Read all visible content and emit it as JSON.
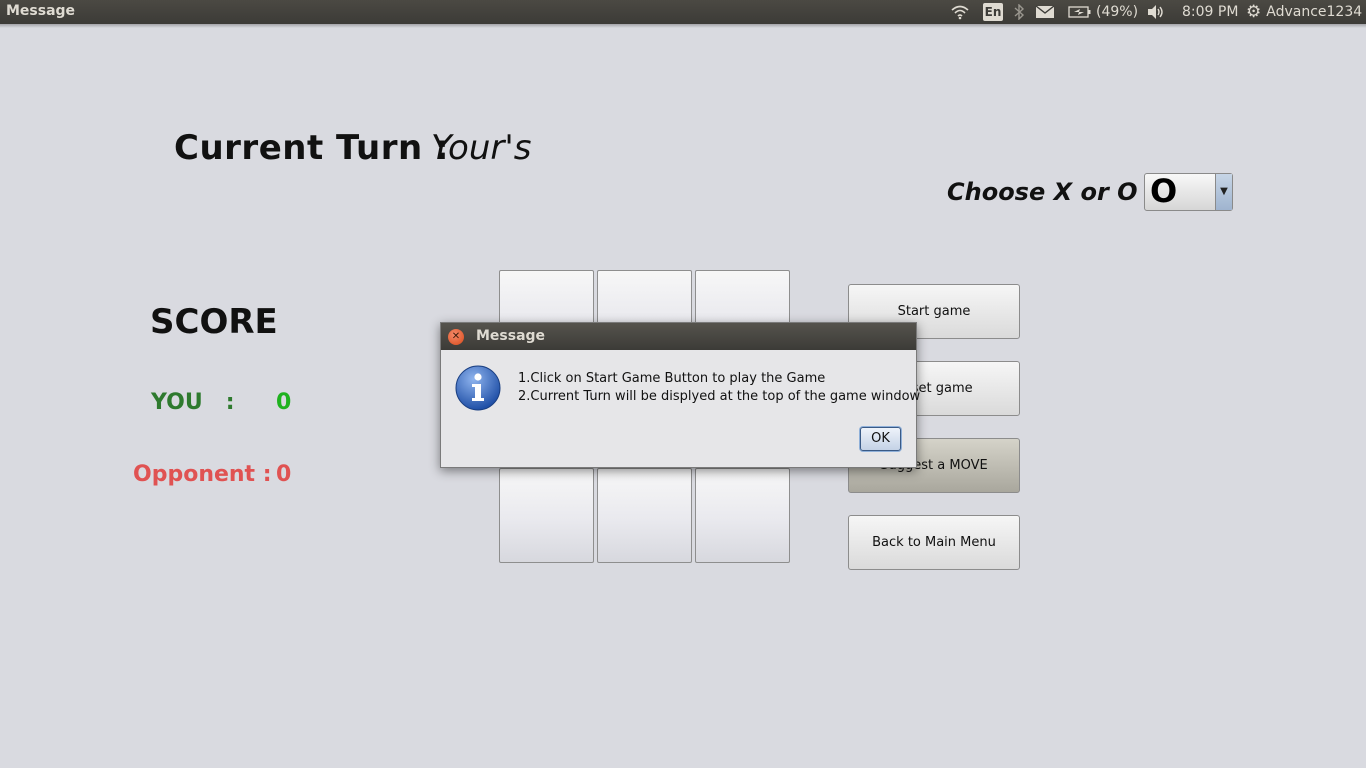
{
  "topbar": {
    "title": "Message",
    "lang": "En",
    "battery": "(49%)",
    "time": "8:09 PM",
    "user": "Advance1234",
    "icons": [
      "wifi-icon",
      "bluetooth-icon",
      "mail-icon",
      "battery-icon",
      "volume-icon",
      "gear-icon"
    ]
  },
  "game": {
    "turn_label": "Current Turn :",
    "turn_value": "Your's",
    "choose_label": "Choose X or O :",
    "choose_value": "O",
    "score_title": "SCORE",
    "you_label": "YOU   :",
    "you_score": "0",
    "opponent_label": "Opponent :",
    "opponent_score": "0",
    "board": [
      "",
      "",
      "",
      "",
      "",
      "",
      "",
      "",
      ""
    ]
  },
  "buttons": {
    "start": "Start game",
    "reset": "Reset game",
    "suggest": "Suggest a MOVE",
    "back": "Back to Main Menu"
  },
  "dialog": {
    "title": "Message",
    "line1": "1.Click on Start Game Button to play the Game",
    "line2": "2.Current Turn will be displyed at the top of the game window",
    "ok": "OK"
  },
  "colors": {
    "background": "#d9dae0",
    "you": "#2e7a2e",
    "you_score": "#1fb21f",
    "opponent": "#e05252",
    "panel": "#3c3b37"
  }
}
